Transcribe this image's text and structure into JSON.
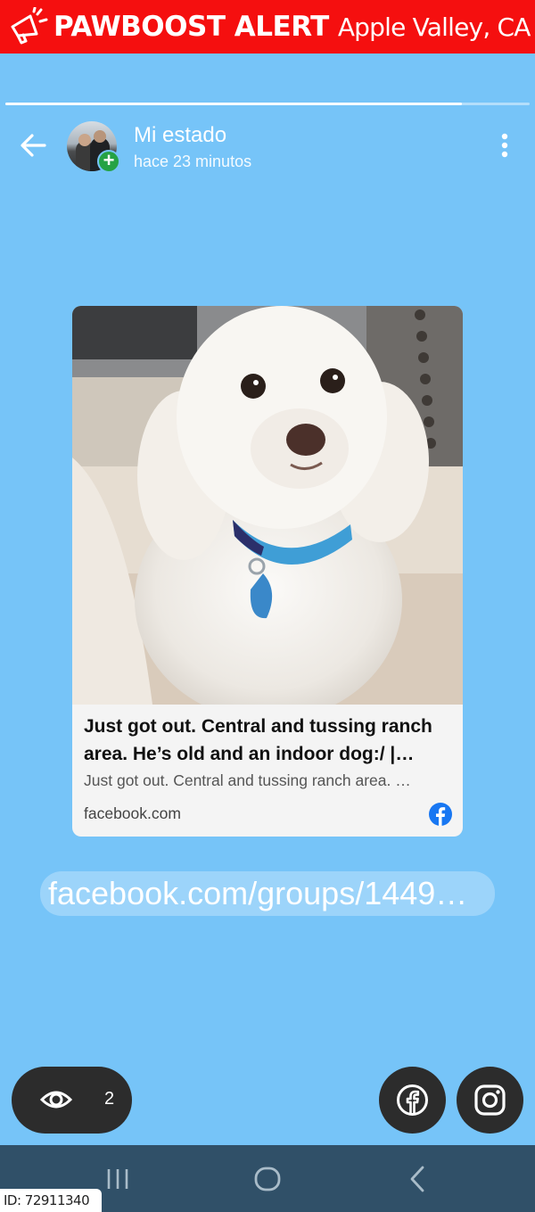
{
  "banner": {
    "brand": "PAWBOOST ALERT",
    "location": "Apple Valley, CA",
    "icon": "megaphone-icon",
    "color": "#f50f0f"
  },
  "story": {
    "progress_fraction": 0.87,
    "title": "Mi estado",
    "time": "hace 23 minutos",
    "back_icon": "arrow-left-icon",
    "menu_icon": "more-vertical-icon",
    "add_icon": "plus-icon",
    "background": "#76c4f8"
  },
  "card": {
    "title": "Just got out. Central and tussing ranch area. He’s old and an indoor dog:/ | Fac…",
    "description": "Just got out. Central and tussing ranch area. …",
    "domain": "facebook.com",
    "icon": "facebook-icon"
  },
  "link": {
    "text": "facebook.com/groups/1449…"
  },
  "footer": {
    "views_icon": "eye-icon",
    "views_count": "2",
    "share_facebook_icon": "facebook-icon",
    "share_instagram_icon": "instagram-icon"
  },
  "navbar": {
    "recents_icon": "recents-icon",
    "home_icon": "home-icon",
    "back_icon": "back-chevron-icon"
  },
  "id_tag": "ID: 72911340"
}
